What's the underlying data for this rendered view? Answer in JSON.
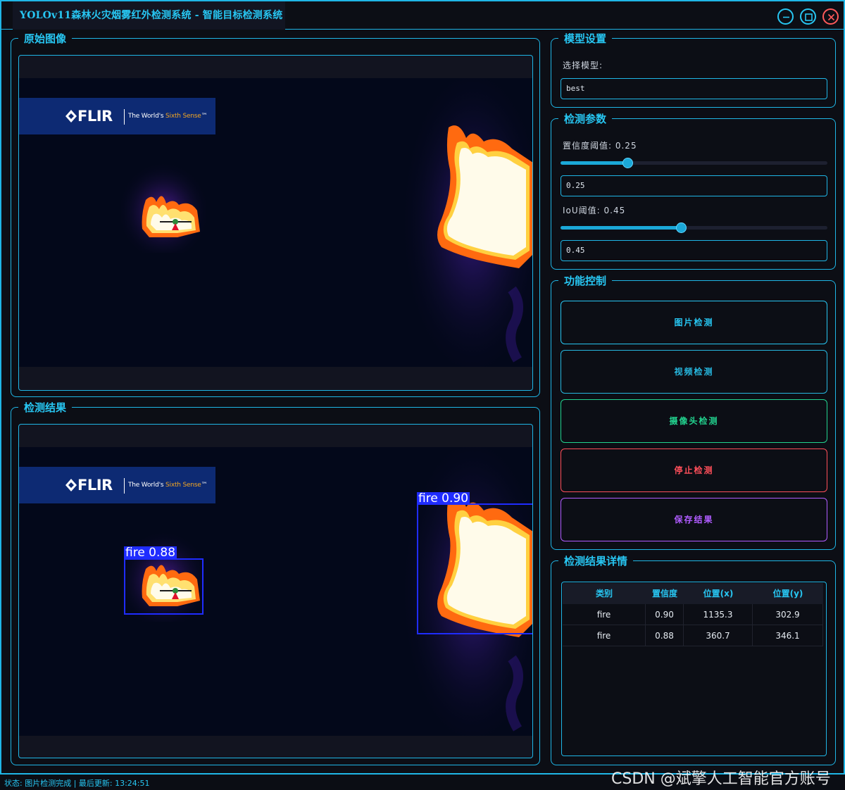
{
  "window": {
    "title": "YOLOv11森林火灾烟雾红外检测系统 - 智能目标检测系统"
  },
  "original_panel": {
    "title": "原始图像",
    "flir_logo": "FLIR",
    "flir_tagline_prefix": "The World's ",
    "flir_tagline_highlight": "Sixth Sense",
    "flir_tagline_suffix": "™"
  },
  "result_panel": {
    "title": "检测结果",
    "detections": [
      {
        "label": "fire 0.88"
      },
      {
        "label": "fire 0.90"
      }
    ]
  },
  "model_settings": {
    "title": "模型设置",
    "select_label": "选择模型:",
    "selected_model": "best"
  },
  "detect_params": {
    "title": "检测参数",
    "confidence_label": "置信度阈值: 0.25",
    "confidence_value": "0.25",
    "confidence_fraction": 0.25,
    "iou_label": "IoU阈值: 0.45",
    "iou_value": "0.45",
    "iou_fraction": 0.45
  },
  "function_control": {
    "title": "功能控制",
    "buttons": [
      {
        "label": "图片检测",
        "color": "#27c6f2"
      },
      {
        "label": "视频检测",
        "color": "#27b8e0"
      },
      {
        "label": "摄像头检测",
        "color": "#22d38f"
      },
      {
        "label": "停止检测",
        "color": "#ff4f5a"
      },
      {
        "label": "保存结果",
        "color": "#b05cff"
      }
    ]
  },
  "result_details": {
    "title": "检测结果详情",
    "columns": [
      "类别",
      "置信度",
      "位置(x)",
      "位置(y)"
    ],
    "rows": [
      [
        "fire",
        "0.90",
        "1135.3",
        "302.9"
      ],
      [
        "fire",
        "0.88",
        "360.7",
        "346.1"
      ]
    ]
  },
  "status": {
    "text": "状态: 图片检测完成 | 最后更新: 13:24:51"
  },
  "watermark": "CSDN @斌擎人工智能官方账号",
  "colors": {
    "accent": "#1fb6e6",
    "box": "#1f2cff"
  }
}
